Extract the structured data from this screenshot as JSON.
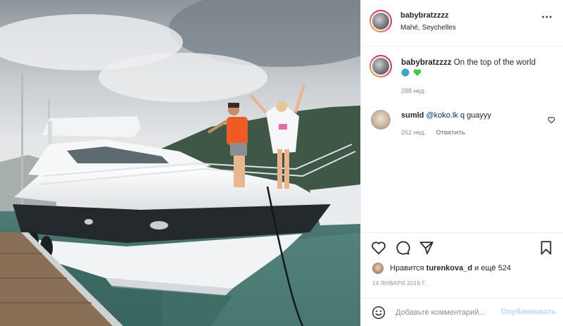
{
  "post": {
    "username": "babybratzzzz",
    "location": "Mahé, Seychelles",
    "more_icon": "more-horizontal-icon"
  },
  "caption": {
    "username": "babybratzzzz",
    "text": "On the top of the world",
    "emojis": [
      "globe-emoji",
      "green-heart-emoji"
    ],
    "age": "288 нед."
  },
  "comments": [
    {
      "username": "sumld",
      "mention": "@koko.lk",
      "text": "q guayyy",
      "age": "262 нед.",
      "reply_label": "Ответить"
    }
  ],
  "actions": {
    "icons": [
      "heart-icon",
      "comment-icon",
      "share-icon",
      "bookmark-icon"
    ]
  },
  "likes": {
    "prefix": "Нравится",
    "user": "turenkova_d",
    "suffix": "и ещё 524"
  },
  "date": "14 ЯНВАРЯ 2016 Г.",
  "add_comment": {
    "placeholder": "Добавьте комментарий...",
    "publish_label": "Опубликовать"
  },
  "colors": {
    "link": "#00376b",
    "publish_disabled": "#b3dbff",
    "muted": "#8e8e8e"
  }
}
